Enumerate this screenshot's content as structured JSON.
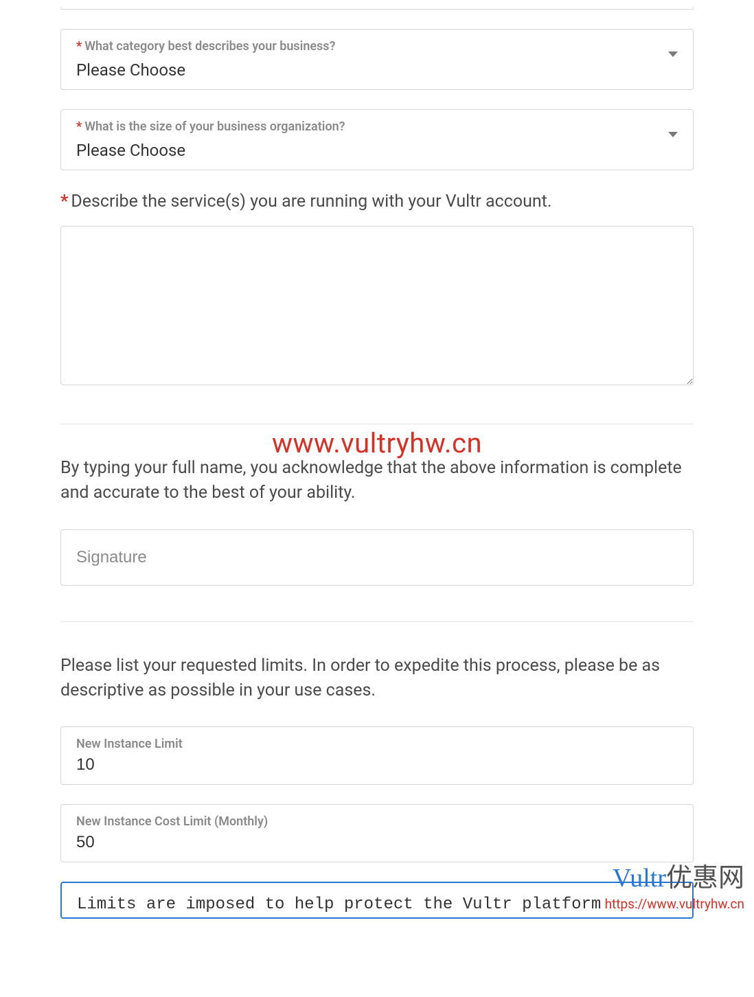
{
  "form": {
    "category": {
      "label": "What category best describes your business?",
      "value": "Please Choose"
    },
    "size": {
      "label": "What is the size of your business organization?",
      "value": "Please Choose"
    },
    "describe": {
      "label": "Describe the service(s) you are running with your Vultr account.",
      "value": ""
    },
    "acknowledge": "By typing your full name, you acknowledge that the above information is complete and accurate to the best of your ability.",
    "signature": {
      "placeholder": "Signature",
      "value": ""
    },
    "limits_intro": "Please list your requested limits. In order to expedite this process, please be as descriptive as possible in your use cases.",
    "instance_limit": {
      "label": "New Instance Limit",
      "value": "10"
    },
    "cost_limit": {
      "label": "New Instance Cost Limit (Monthly)",
      "value": "50"
    },
    "limits_note": "Limits are imposed to help protect the Vultr platform"
  },
  "watermarks": {
    "center": "www.vultryhw.cn",
    "logo_brand": "Vultr",
    "logo_suffix": "优惠网",
    "url": "https://www.vultryhw.cn"
  }
}
